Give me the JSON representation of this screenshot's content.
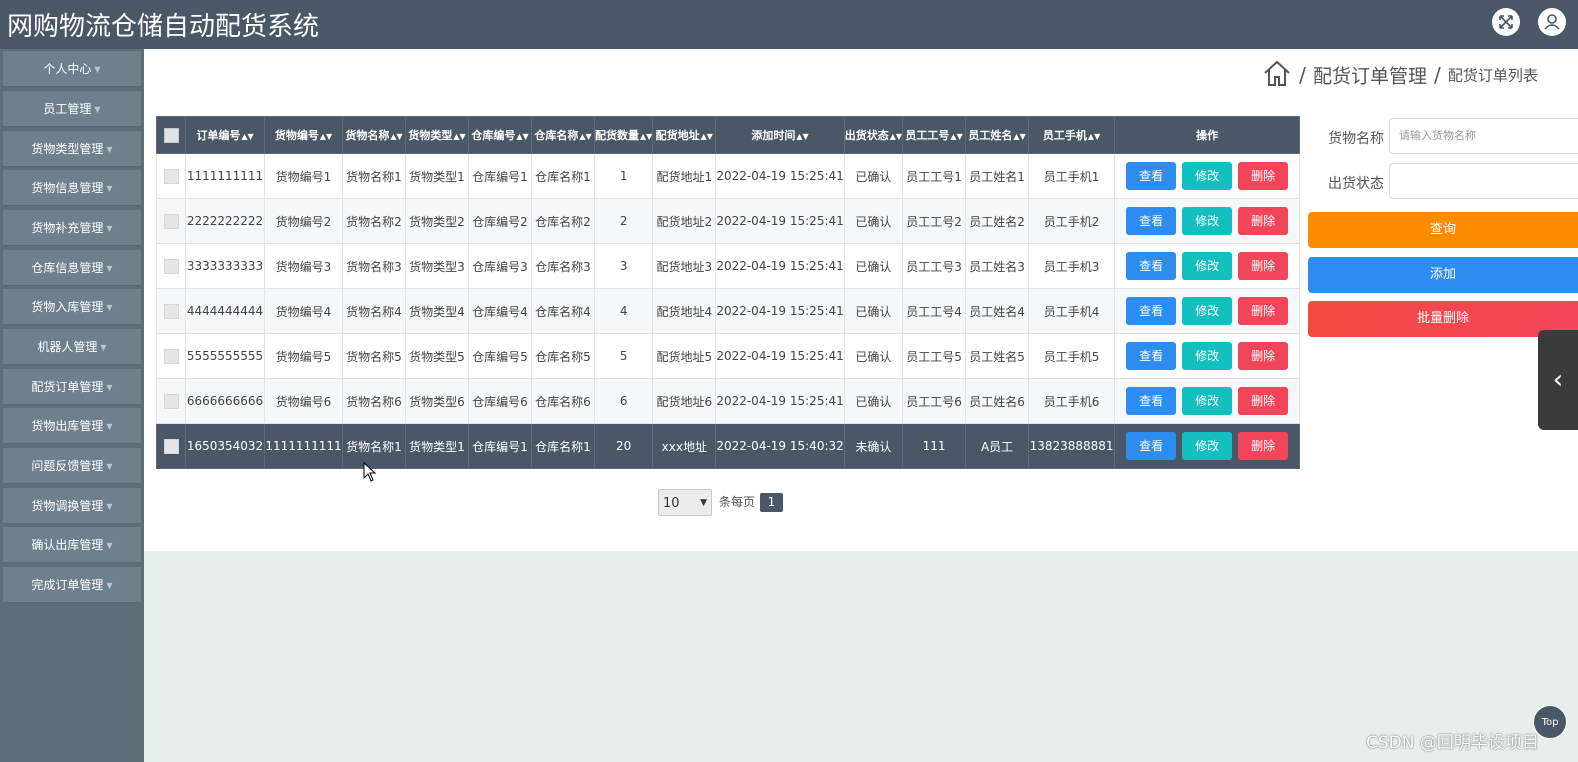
{
  "header": {
    "title": "网购物流仓储自动配货系统",
    "fullscreen_icon": "expand-icon",
    "user_icon": "user-icon"
  },
  "sidebar": {
    "items": [
      {
        "label": "个人中心"
      },
      {
        "label": "员工管理"
      },
      {
        "label": "货物类型管理"
      },
      {
        "label": "货物信息管理"
      },
      {
        "label": "货物补充管理"
      },
      {
        "label": "仓库信息管理"
      },
      {
        "label": "货物入库管理"
      },
      {
        "label": "机器人管理"
      },
      {
        "label": "配货订单管理"
      },
      {
        "label": "货物出库管理"
      },
      {
        "label": "问题反馈管理"
      },
      {
        "label": "货物调换管理"
      },
      {
        "label": "确认出库管理"
      },
      {
        "label": "完成订单管理"
      }
    ]
  },
  "breadcrumb": {
    "separator": "/",
    "parent": "配货订单管理",
    "current": "配货订单列表"
  },
  "table": {
    "columns": [
      "订单编号",
      "货物编号",
      "货物名称",
      "货物类型",
      "仓库编号",
      "仓库名称",
      "配货数量",
      "配货地址",
      "添加时间",
      "出货状态",
      "员工工号",
      "员工姓名",
      "员工手机",
      "操作"
    ],
    "rows": [
      [
        "1111111111",
        "货物编号1",
        "货物名称1",
        "货物类型1",
        "仓库编号1",
        "仓库名称1",
        "1",
        "配货地址1",
        "2022-04-19 15:25:41",
        "已确认",
        "员工工号1",
        "员工姓名1",
        "员工手机1"
      ],
      [
        "2222222222",
        "货物编号2",
        "货物名称2",
        "货物类型2",
        "仓库编号2",
        "仓库名称2",
        "2",
        "配货地址2",
        "2022-04-19 15:25:41",
        "已确认",
        "员工工号2",
        "员工姓名2",
        "员工手机2"
      ],
      [
        "3333333333",
        "货物编号3",
        "货物名称3",
        "货物类型3",
        "仓库编号3",
        "仓库名称3",
        "3",
        "配货地址3",
        "2022-04-19 15:25:41",
        "已确认",
        "员工工号3",
        "员工姓名3",
        "员工手机3"
      ],
      [
        "4444444444",
        "货物编号4",
        "货物名称4",
        "货物类型4",
        "仓库编号4",
        "仓库名称4",
        "4",
        "配货地址4",
        "2022-04-19 15:25:41",
        "已确认",
        "员工工号4",
        "员工姓名4",
        "员工手机4"
      ],
      [
        "5555555555",
        "货物编号5",
        "货物名称5",
        "货物类型5",
        "仓库编号5",
        "仓库名称5",
        "5",
        "配货地址5",
        "2022-04-19 15:25:41",
        "已确认",
        "员工工号5",
        "员工姓名5",
        "员工手机5"
      ],
      [
        "6666666666",
        "货物编号6",
        "货物名称6",
        "货物类型6",
        "仓库编号6",
        "仓库名称6",
        "6",
        "配货地址6",
        "2022-04-19 15:25:41",
        "已确认",
        "员工工号6",
        "员工姓名6",
        "员工手机6"
      ],
      [
        "1650354032",
        "1111111111",
        "货物名称1",
        "货物类型1",
        "仓库编号1",
        "仓库名称1",
        "20",
        "xxx地址",
        "2022-04-19 15:40:32",
        "未确认",
        "111",
        "A员工",
        "13823888881"
      ]
    ],
    "actions": {
      "view": "查看",
      "edit": "修改",
      "delete": "删除"
    }
  },
  "pagination": {
    "page_size": "10",
    "per_page_label": "条每页",
    "current_page": "1"
  },
  "search": {
    "goods_name_label": "货物名称",
    "goods_name_placeholder": "请输入货物名称",
    "status_label": "出货状态",
    "query_button": "查询",
    "add_button": "添加",
    "batch_delete_button": "批量删除"
  },
  "floating": {
    "back_to_top": "Top"
  },
  "watermark": "CSDN @回明毕设项目",
  "colors": {
    "header_bg": "#495766",
    "sidebar_bg": "#5a6f7a",
    "view": "#2d8cf0",
    "edit": "#13bfbf",
    "delete": "#f2455a",
    "query": "#ff8c00",
    "add": "#2d8cf0",
    "batch_delete": "#f2455a"
  }
}
